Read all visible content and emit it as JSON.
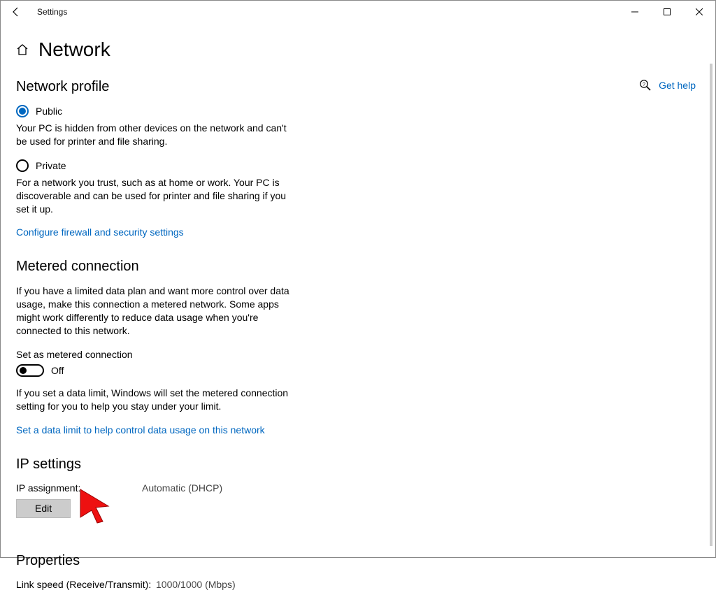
{
  "titlebar": {
    "caption": "Settings"
  },
  "header": {
    "title": "Network"
  },
  "help": {
    "label": "Get help"
  },
  "profile": {
    "section_title": "Network profile",
    "public": {
      "label": "Public",
      "desc": "Your PC is hidden from other devices on the network and can't be used for printer and file sharing."
    },
    "private": {
      "label": "Private",
      "desc": "For a network you trust, such as at home or work. Your PC is discoverable and can be used for printer and file sharing if you set it up."
    },
    "firewall_link": "Configure firewall and security settings"
  },
  "metered": {
    "section_title": "Metered connection",
    "desc": "If you have a limited data plan and want more control over data usage, make this connection a metered network. Some apps might work differently to reduce data usage when you're connected to this network.",
    "toggle_label": "Set as metered connection",
    "toggle_state": "Off",
    "limit_desc": "If you set a data limit, Windows will set the metered connection setting for you to help you stay under your limit.",
    "limit_link": "Set a data limit to help control data usage on this network"
  },
  "ip": {
    "section_title": "IP settings",
    "assignment_label": "IP assignment:",
    "assignment_value": "Automatic (DHCP)",
    "edit_label": "Edit"
  },
  "properties": {
    "section_title": "Properties",
    "link_speed_label": "Link speed (Receive/Transmit):",
    "link_speed_value": "1000/1000 (Mbps)"
  }
}
